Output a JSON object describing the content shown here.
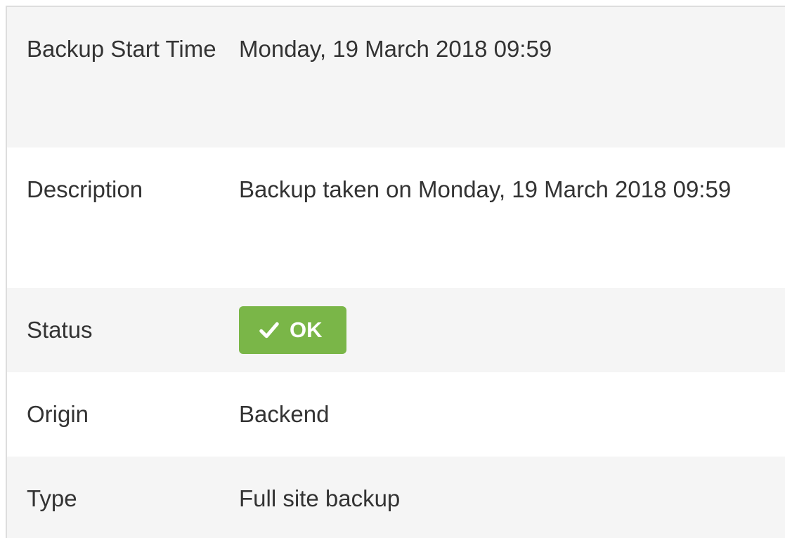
{
  "details": {
    "rows": [
      {
        "label": "Backup Start Time",
        "value": "Monday, 19 March 2018 09:59"
      },
      {
        "label": "Description",
        "value": "Backup taken on Monday, 19 March 2018 09:59"
      },
      {
        "label": "Status",
        "value": "OK",
        "badge_color": "#7ab648"
      },
      {
        "label": "Origin",
        "value": "Backend"
      },
      {
        "label": "Type",
        "value": "Full site backup"
      }
    ]
  },
  "icons": {
    "status_icon": "check-icon"
  }
}
